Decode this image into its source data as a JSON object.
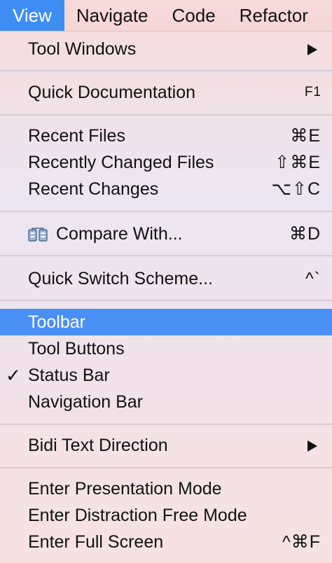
{
  "menubar": {
    "items": [
      {
        "label": "View",
        "active": true
      },
      {
        "label": "Navigate",
        "active": false
      },
      {
        "label": "Code",
        "active": false
      },
      {
        "label": "Refactor",
        "active": false
      }
    ]
  },
  "menu": {
    "tool_windows": {
      "label": "Tool Windows"
    },
    "quick_documentation": {
      "label": "Quick Documentation",
      "shortcut": "F1"
    },
    "recent_files": {
      "label": "Recent Files",
      "shortcut": "⌘E"
    },
    "recently_changed_files": {
      "label": "Recently Changed Files",
      "shortcut": "⇧⌘E"
    },
    "recent_changes": {
      "label": "Recent Changes",
      "shortcut": "⌥⇧C"
    },
    "compare_with": {
      "label": "Compare With...",
      "shortcut": "⌘D",
      "icon": "compare-icon"
    },
    "quick_switch_scheme": {
      "label": "Quick Switch Scheme...",
      "shortcut": "^`"
    },
    "toolbar": {
      "label": "Toolbar",
      "highlighted": true
    },
    "tool_buttons": {
      "label": "Tool Buttons"
    },
    "status_bar": {
      "label": "Status Bar",
      "checked": true,
      "check": "✓"
    },
    "navigation_bar": {
      "label": "Navigation Bar"
    },
    "bidi_text_direction": {
      "label": "Bidi Text Direction"
    },
    "enter_presentation_mode": {
      "label": "Enter Presentation Mode"
    },
    "enter_distraction_free_mode": {
      "label": "Enter Distraction Free Mode"
    },
    "enter_full_screen": {
      "label": "Enter Full Screen",
      "shortcut": "^⌘F"
    }
  },
  "colors": {
    "highlight": "#4a8ff5",
    "active_menu": "#3e8df3"
  }
}
